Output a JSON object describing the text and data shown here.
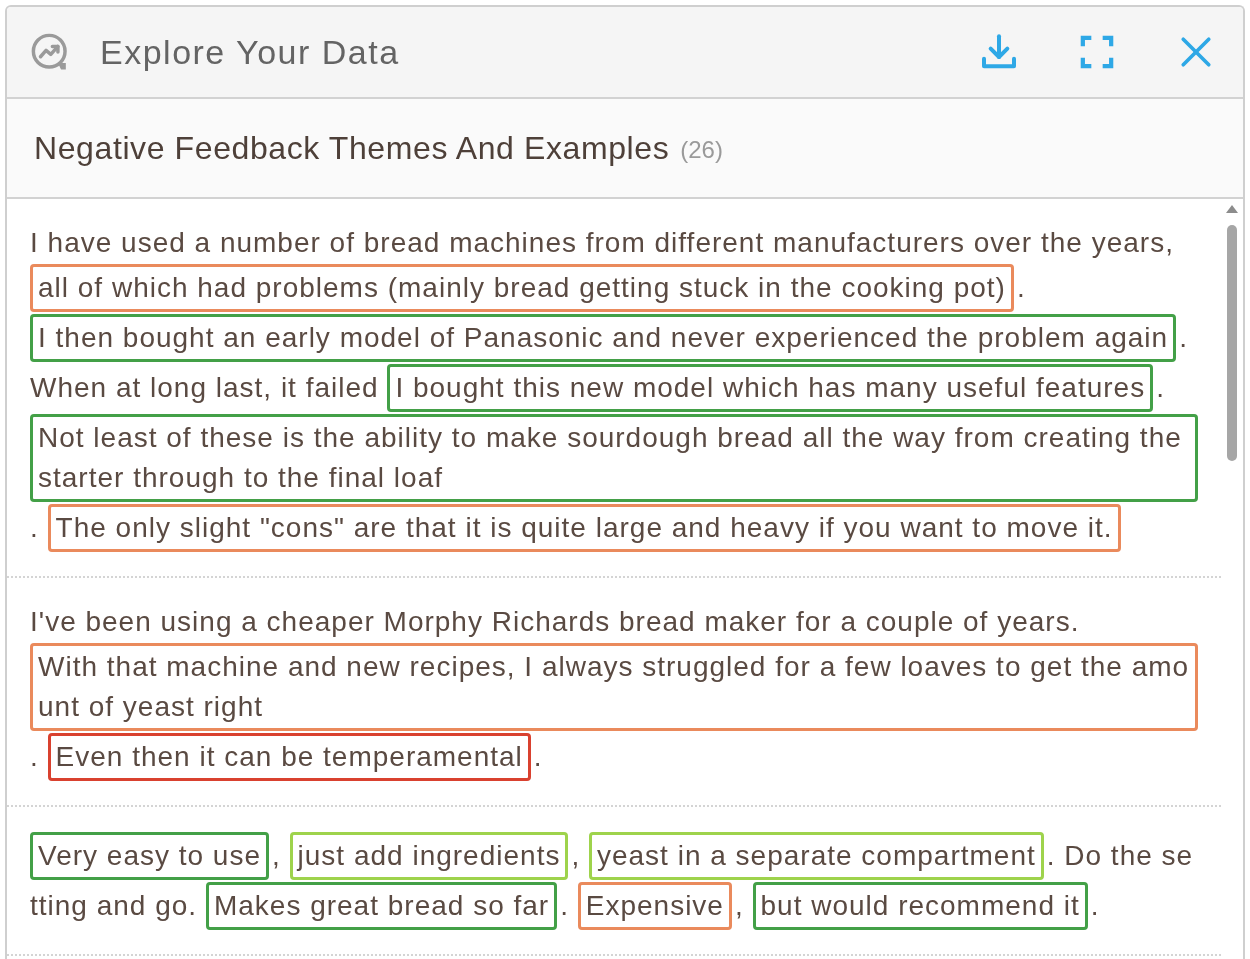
{
  "window": {
    "title": "Explore Your Data"
  },
  "panel": {
    "title": "Negative Feedback Themes And Examples",
    "count": "(26)"
  },
  "reviews": [
    {
      "segments": [
        {
          "kind": "plain",
          "text": "I have used a number of bread machines from different manufacturers over the years, "
        },
        {
          "kind": "highlight",
          "color": "#ea8a5c",
          "text": "all of which had problems (mainly bread getting stuck in the cooking pot)"
        },
        {
          "kind": "plain",
          "text": "."
        },
        {
          "kind": "highlight",
          "color": "#43a047",
          "text": "I then bought an early model of Panasonic and never experienced the problem again"
        },
        {
          "kind": "plain",
          "text": ". When at long last, it failed "
        },
        {
          "kind": "highlight",
          "color": "#43a047",
          "text": "I bought this new model which has many useful features"
        },
        {
          "kind": "plain",
          "text": "."
        },
        {
          "kind": "highlight",
          "color": "#43a047",
          "text": "Not least of these is the ability to make sourdough bread all the way from creating the starter through to the final loaf"
        },
        {
          "kind": "plain",
          "text": ". "
        },
        {
          "kind": "highlight",
          "color": "#ea8a5c",
          "text": "The only slight \"cons\" are that it is quite large and heavy if you want to move it."
        }
      ]
    },
    {
      "segments": [
        {
          "kind": "plain",
          "text": "I've been using a cheaper Morphy Richards bread maker for a couple of years. "
        },
        {
          "kind": "highlight",
          "color": "#ea8a5c",
          "text": "With that machine and new recipes, I always struggled for a few loaves to get the amount of yeast right"
        },
        {
          "kind": "plain",
          "text": ". "
        },
        {
          "kind": "highlight",
          "color": "#d9412f",
          "text": "Even then it can be temperamental"
        },
        {
          "kind": "plain",
          "text": "."
        }
      ]
    },
    {
      "segments": [
        {
          "kind": "highlight",
          "color": "#43a047",
          "text": "Very easy to use"
        },
        {
          "kind": "plain",
          "text": ", "
        },
        {
          "kind": "highlight",
          "color": "#9ed34c",
          "text": "just add ingredients"
        },
        {
          "kind": "plain",
          "text": ", "
        },
        {
          "kind": "highlight",
          "color": "#9ed34c",
          "text": "yeast in a separate compartment"
        },
        {
          "kind": "plain",
          "text": ". Do the setting and go. "
        },
        {
          "kind": "highlight",
          "color": "#43a047",
          "text": "Makes great bread so far"
        },
        {
          "kind": "plain",
          "text": ". "
        },
        {
          "kind": "highlight",
          "color": "#ea8a5c",
          "text": "Expensive"
        },
        {
          "kind": "plain",
          "text": ", "
        },
        {
          "kind": "highlight",
          "color": "#43a047",
          "text": "but would recommend it"
        },
        {
          "kind": "plain",
          "text": "."
        }
      ]
    }
  ]
}
